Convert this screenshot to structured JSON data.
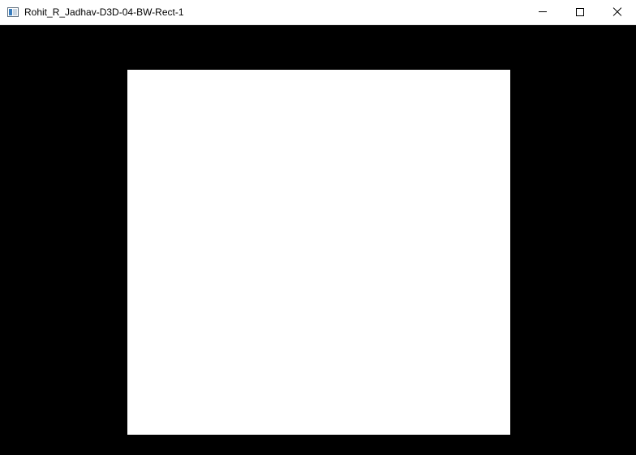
{
  "window": {
    "title": "Rohit_R_Jadhav-D3D-04-BW-Rect-1",
    "icon": "application-window-icon",
    "controls": {
      "minimize_icon": "minimize-icon",
      "maximize_icon": "maximize-icon",
      "close_icon": "close-icon"
    }
  },
  "scene": {
    "background_color": "#000000",
    "rectangle_color": "#ffffff"
  }
}
